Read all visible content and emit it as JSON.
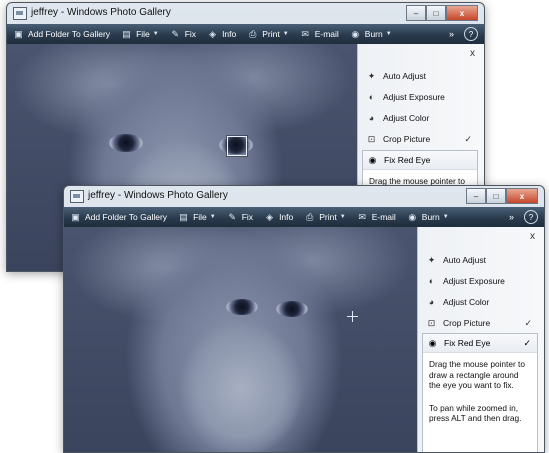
{
  "window": {
    "title": "jeffrey - Windows Photo Gallery",
    "controls": {
      "minimize": "–",
      "maximize": "□",
      "close": "x"
    }
  },
  "toolbar": {
    "add_folder": "Add Folder To Gallery",
    "file": "File",
    "fix": "Fix",
    "info": "Info",
    "print": "Print",
    "email": "E-mail",
    "burn": "Burn",
    "more": "»",
    "help": "?"
  },
  "panel": {
    "close": "x",
    "items": [
      "Auto Adjust",
      "Adjust Exposure",
      "Adjust Color",
      "Crop Picture"
    ],
    "crop_check": "✓",
    "fix_red_eye": {
      "label": "Fix Red Eye",
      "check": "✓",
      "instruction": "Drag the mouse pointer to draw a rectangle around the eye you want to fix.",
      "instruction_partial": "Drag the mouse pointer to draw a rectangle around the",
      "pan_tip": "To pan while zoomed in, press ALT and then drag."
    }
  },
  "colors": {
    "toolbar": "#2a3b4e",
    "panel": "#eef1f5",
    "photo_tint": "#6e7893"
  }
}
